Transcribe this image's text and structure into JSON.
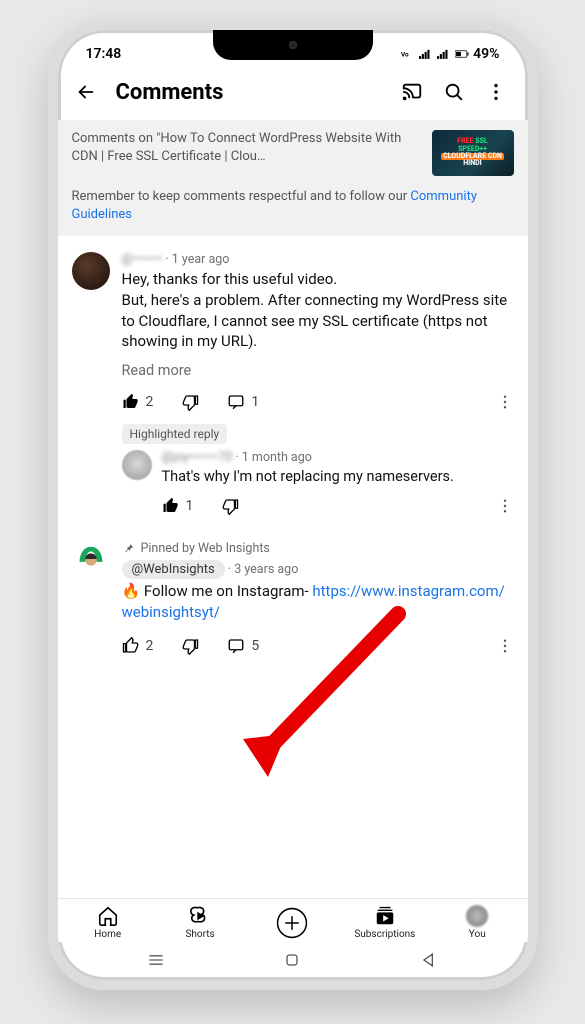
{
  "status": {
    "time": "17:48",
    "battery": "49%"
  },
  "header": {
    "title": "Comments"
  },
  "banner": {
    "context": "Comments on \"How To Connect WordPress Website With CDN | Free SSL Certificate | Clou…",
    "guidelines_prefix": "Remember to keep comments respectful and to follow our ",
    "guidelines_link": "Community Guidelines",
    "thumb_lines": {
      "a": "FREE",
      "b": "SSL",
      "c": "SPEED++",
      "d": "CLOUDFLARE CDN",
      "e": "HINDI"
    }
  },
  "comments": [
    {
      "author": "@•••••••",
      "age": "1 year ago",
      "text": "Hey, thanks for this useful video.\nBut, here's a problem. After connecting my WordPress site to Cloudflare, I cannot see my SSL certificate (https not showing in my URL).",
      "read_more": "Read more",
      "like_count": "2",
      "reply_count": "1",
      "reply": {
        "badge": "Highlighted reply",
        "author": "@joy•••••••70",
        "age": "1 month ago",
        "text": "That's why I'm not replacing my nameservers.",
        "like_count": "1"
      }
    },
    {
      "pinned_by": "Pinned by Web Insights",
      "author_chip": "@WebInsights",
      "age": "3 years ago",
      "text_prefix": "🔥 Follow me on Instagram- ",
      "link": "https://www.instagram.com/webinsightsyt/",
      "like_count": "2",
      "reply_count": "5"
    }
  ],
  "nav": {
    "home": "Home",
    "shorts": "Shorts",
    "subs": "Subscriptions",
    "you": "You"
  }
}
